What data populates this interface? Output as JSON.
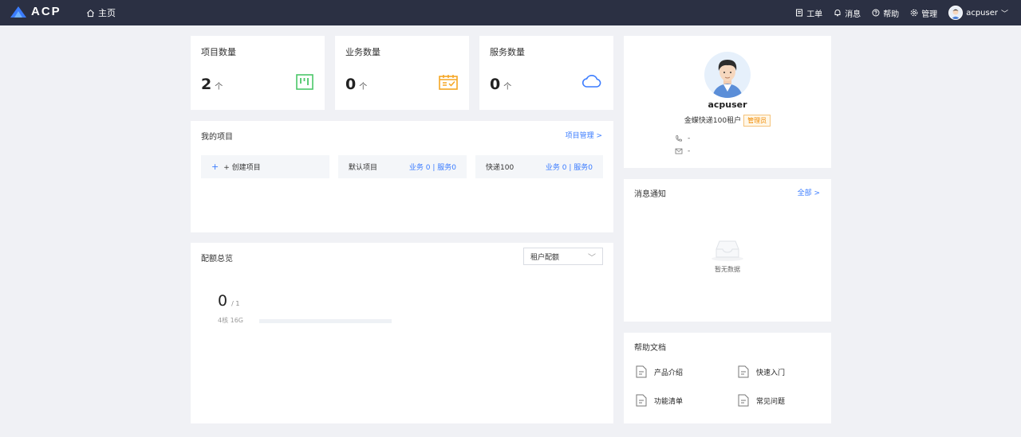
{
  "header": {
    "logo_text": "ACP",
    "home_label": "主页",
    "nav": {
      "ticket": "工单",
      "message": "消息",
      "help": "帮助",
      "manage": "管理"
    },
    "username": "acpuser",
    "brand_color": "#3b7cff",
    "bar_color": "#2b3043"
  },
  "stats": [
    {
      "title": "项目数量",
      "value": "2",
      "unit": "个",
      "icon": "board-icon",
      "color": "#4bc769"
    },
    {
      "title": "业务数量",
      "value": "0",
      "unit": "个",
      "icon": "calendar-check-icon",
      "color": "#f5a623"
    },
    {
      "title": "服务数量",
      "value": "0",
      "unit": "个",
      "icon": "cloud-icon",
      "color": "#3b7cff"
    }
  ],
  "projects": {
    "title": "我的项目",
    "manage_link": "项目管理 >",
    "create_label": "+ 创建项目",
    "items": [
      {
        "name": "默认项目",
        "stats": "业务 0 | 服务0"
      },
      {
        "name": "快递100",
        "stats": "业务 0 | 服务0"
      }
    ]
  },
  "quota": {
    "title": "配额总览",
    "select_value": "租户配额",
    "value": "0",
    "total": "/ 1",
    "label": "4核 16G",
    "progress": 0
  },
  "profile": {
    "name": "acpuser",
    "org": "金蝶快递100租户",
    "role": "管理员",
    "phone": "-",
    "email": "-"
  },
  "notifications": {
    "title": "消息通知",
    "all_link": "全部 >",
    "empty_text": "暂无数据"
  },
  "help_docs": {
    "title": "帮助文档",
    "items": [
      {
        "label": "产品介绍"
      },
      {
        "label": "快速入门"
      },
      {
        "label": "功能清单"
      },
      {
        "label": "常见问题"
      }
    ]
  }
}
